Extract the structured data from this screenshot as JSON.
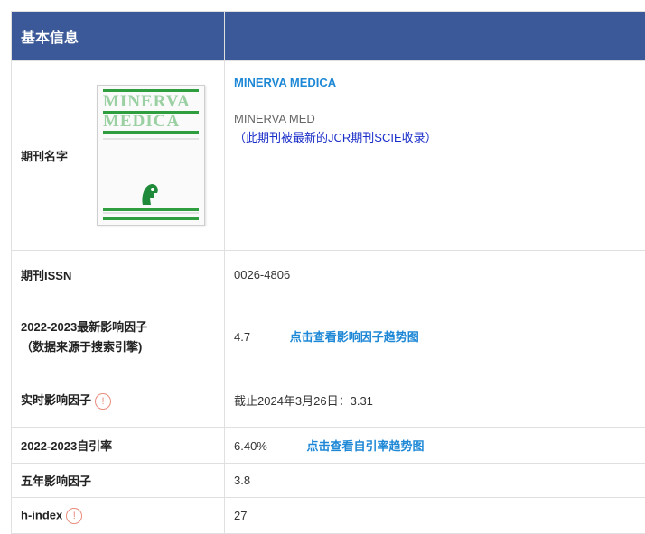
{
  "header": {
    "title": "基本信息"
  },
  "journal": {
    "label": "期刊名字",
    "name": "MINERVA MEDICA",
    "abbr": "MINERVA MED",
    "note": "（此期刊被最新的JCR期刊SCIE收录）",
    "cover_title_1": "MINERVA",
    "cover_title_2": "MEDICA"
  },
  "issn": {
    "label": "期刊ISSN",
    "value": "0026-4806"
  },
  "impact_factor": {
    "label_line1": "2022-2023最新影响因子",
    "label_line2": "（数据来源于搜索引擎)",
    "value": "4.7",
    "link": "点击查看影响因子趋势图"
  },
  "realtime_if": {
    "label": "实时影响因子",
    "value": "截止2024年3月26日：3.31",
    "icon": "info-icon"
  },
  "self_citation": {
    "label": "2022-2023自引率",
    "value": "6.40%",
    "link": "点击查看自引率趋势图"
  },
  "five_year_if": {
    "label": "五年影响因子",
    "value": "3.8"
  },
  "h_index": {
    "label": "h-index",
    "value": "27",
    "icon": "info-icon"
  },
  "colors": {
    "header_bg": "#3b5998",
    "link": "#1e88d6",
    "note": "#1a2ec9",
    "icon": "#e88b7b"
  }
}
